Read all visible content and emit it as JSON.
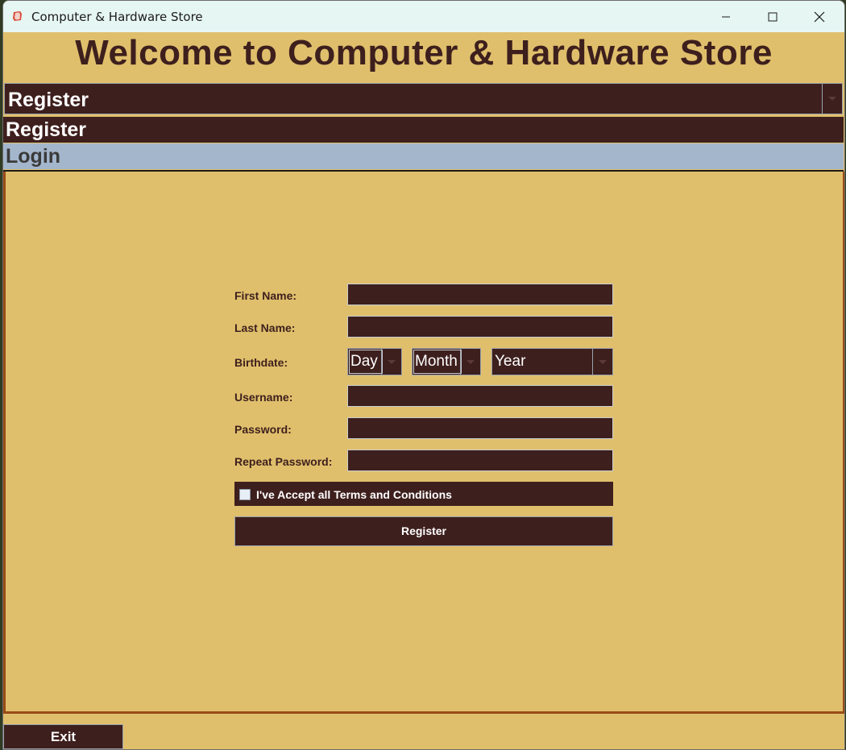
{
  "window": {
    "title": "Computer & Hardware Store",
    "app_icon": "app-icon",
    "controls": {
      "minimize": "–",
      "maximize": "☐",
      "close": "✕"
    }
  },
  "heading": "Welcome to Computer & Hardware Store",
  "mode_select": {
    "selected": "Register",
    "options": [
      "Register",
      "Login"
    ]
  },
  "form": {
    "first_name_label": "First Name:",
    "last_name_label": "Last Name:",
    "birthdate_label": "Birthdate:",
    "day_value": "Day",
    "month_value": "Month",
    "year_value": "Year",
    "username_label": "Username:",
    "password_label": "Password:",
    "repeat_password_label": "Repeat Password:",
    "terms_label": "I've Accept all Terms and Conditions",
    "terms_checked": false,
    "register_button": "Register"
  },
  "footer": {
    "exit_button": "Exit"
  },
  "colors": {
    "background": "#e0bf6c",
    "dark": "#3d1f1d",
    "highlight": "#a4b6cc",
    "panel_border": "#9a4b16"
  }
}
